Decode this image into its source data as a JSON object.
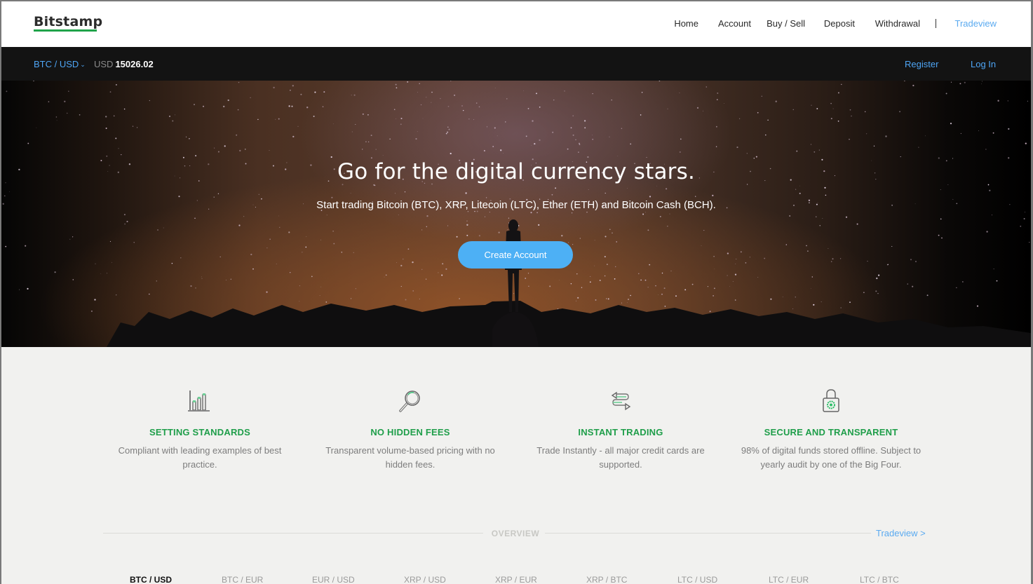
{
  "brand": {
    "name": "Bitstamp",
    "accent_color": "#1fa34a",
    "link_color": "#4ea5f5"
  },
  "nav": {
    "items": [
      {
        "label": "Home"
      },
      {
        "label": "Account"
      },
      {
        "label": "Buy / Sell"
      },
      {
        "label": "Deposit"
      },
      {
        "label": "Withdrawal"
      },
      {
        "label": "Tradeview",
        "active": true
      }
    ]
  },
  "ticker": {
    "pair": "BTC / USD",
    "currency": "USD",
    "price": "15026.02",
    "register": "Register",
    "login": "Log In"
  },
  "hero": {
    "title": "Go for the digital currency stars.",
    "subtitle": "Start trading Bitcoin (BTC), XRP, Litecoin (LTC), Ether (ETH) and Bitcoin Cash (BCH).",
    "cta": "Create Account",
    "cta_color": "#4db0f5"
  },
  "features": [
    {
      "icon": "bar-chart-icon",
      "title": "SETTING STANDARDS",
      "text": "Compliant with leading examples of best practice."
    },
    {
      "icon": "magnifier-icon",
      "title": "NO HIDDEN FEES",
      "text": "Transparent volume-based pricing with no hidden fees."
    },
    {
      "icon": "exchange-arrows-icon",
      "title": "INSTANT TRADING",
      "text": "Trade Instantly - all major credit cards are supported."
    },
    {
      "icon": "padlock-icon",
      "title": "SECURE AND TRANSPARENT",
      "text": "98% of digital funds stored offline. Subject to yearly audit by one of the Big Four."
    }
  ],
  "overview": {
    "title": "OVERVIEW",
    "link": "Tradeview >",
    "tabs": [
      {
        "label": "BTC / USD",
        "active": true
      },
      {
        "label": "BTC / EUR"
      },
      {
        "label": "EUR / USD"
      },
      {
        "label": "XRP / USD"
      },
      {
        "label": "XRP / EUR"
      },
      {
        "label": "XRP / BTC"
      },
      {
        "label": "LTC / USD"
      },
      {
        "label": "LTC / EUR"
      },
      {
        "label": "LTC / BTC"
      }
    ]
  }
}
